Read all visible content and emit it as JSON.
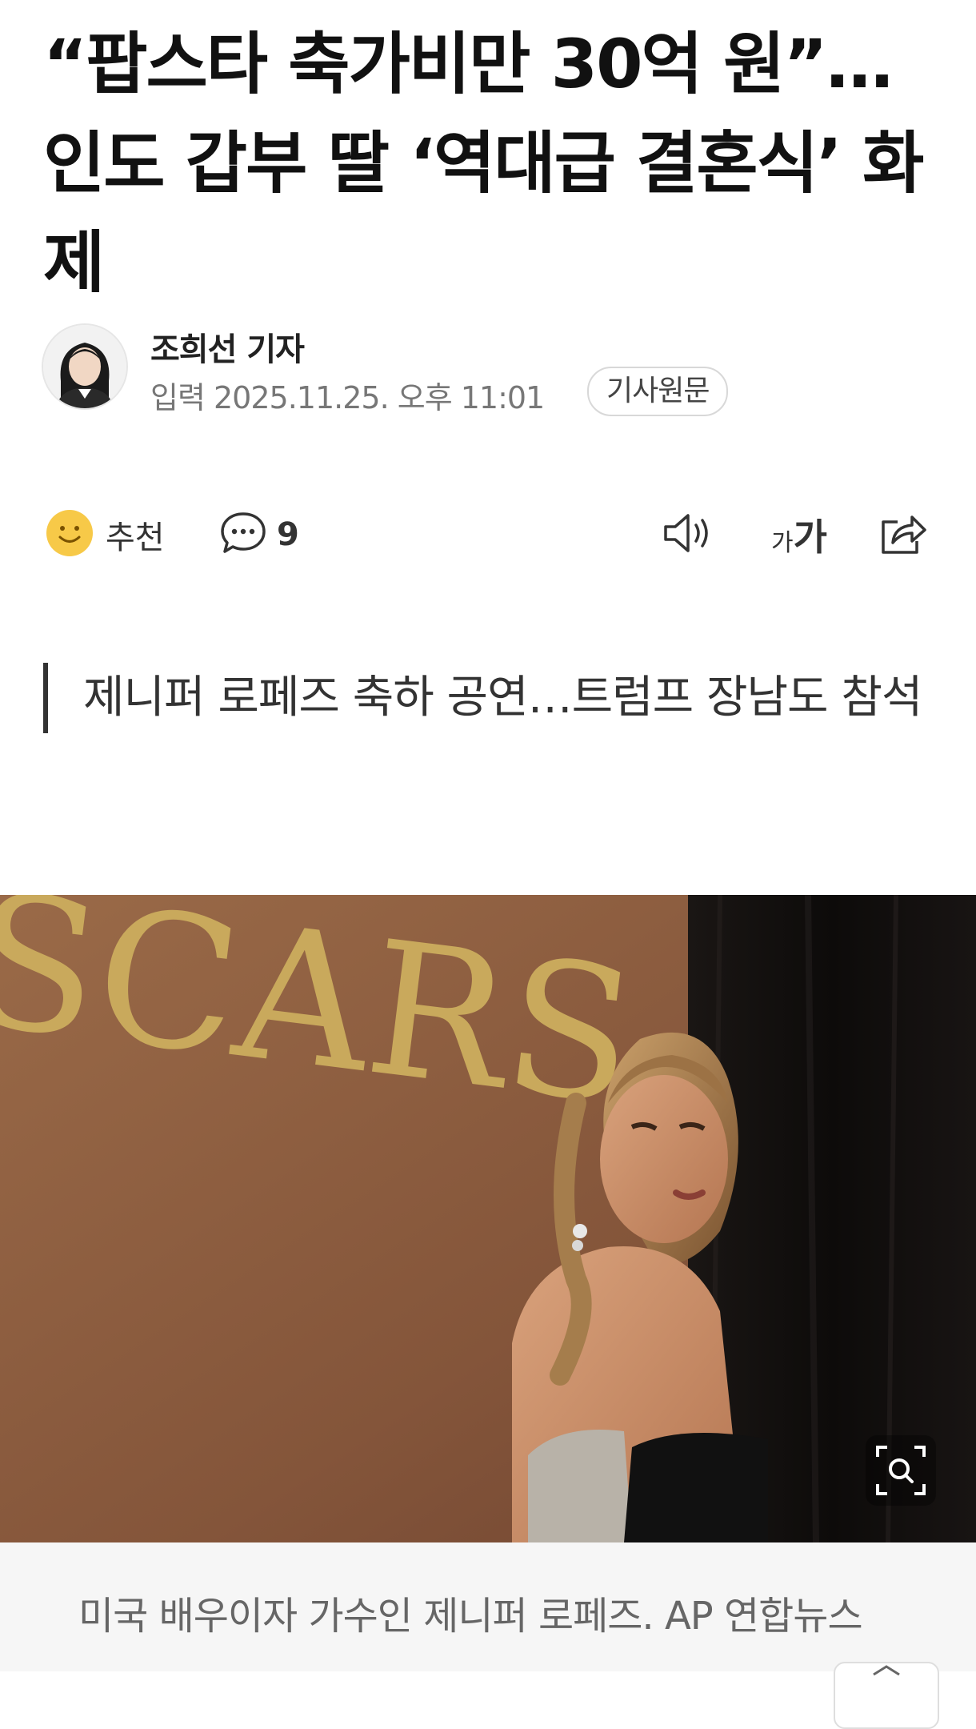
{
  "article": {
    "headline": "“팝스타 축가비만 30억 원”…인도 갑부 딸 ‘역대급 결혼식’ 화제",
    "reporter": "조희선 기자",
    "datetime": "입력 2025.11.25. 오후 11:01",
    "original_button": "기사원문",
    "subtitle": "제니퍼 로페즈 축하 공연…트럼프 장남도 참석"
  },
  "actions": {
    "recommend_label": "추천",
    "recommend_icon": "smile-icon",
    "comment_icon": "comment-icon",
    "comment_count": "9",
    "tts_icon": "speaker-icon",
    "font_size_label_small": "가",
    "font_size_label_large": "가",
    "share_icon": "share-icon"
  },
  "photo": {
    "sign_text": "SCARS",
    "zoom_icon": "zoom-icon",
    "caption": "미국 배우이자 가수인 제니퍼 로페즈. AP 연합뉴스"
  },
  "colors": {
    "background": "#ffffff",
    "accent_yellow": "#f7c948",
    "text_dark": "#111111",
    "text_muted": "#777777"
  }
}
